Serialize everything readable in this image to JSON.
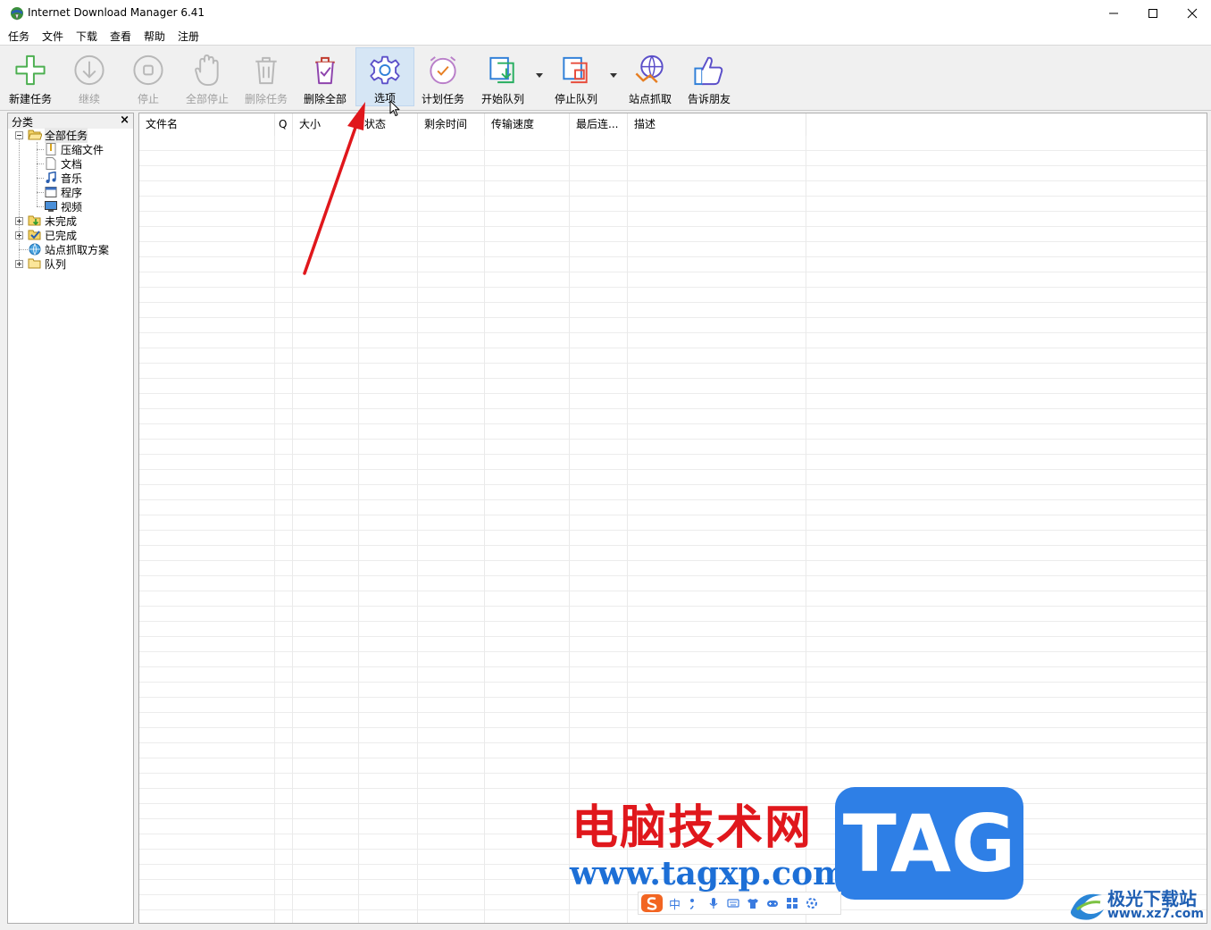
{
  "window": {
    "title": "Internet Download Manager 6.41",
    "minimize_icon": "minimize-icon",
    "maximize_icon": "maximize-icon",
    "close_icon": "close-icon"
  },
  "menu": [
    "任务",
    "文件",
    "下载",
    "查看",
    "帮助",
    "注册"
  ],
  "toolbar": {
    "new_task": "新建任务",
    "resume": "继续",
    "stop": "停止",
    "stop_all": "全部停止",
    "delete_task": "删除任务",
    "delete_all": "删除全部",
    "options": "选项",
    "scheduler": "计划任务",
    "start_queue": "开始队列",
    "stop_queue": "停止队列",
    "site_grabber": "站点抓取",
    "tell_friend": "告诉朋友"
  },
  "sidebar": {
    "title": "分类",
    "close": "×",
    "tree": {
      "all": "全部任务",
      "compressed": "压缩文件",
      "documents": "文档",
      "music": "音乐",
      "programs": "程序",
      "video": "视频",
      "unfinished": "未完成",
      "finished": "已完成",
      "grabber_projects": "站点抓取方案",
      "queues": "队列"
    }
  },
  "columns": [
    "文件名",
    "Q",
    "大小",
    "状态",
    "剩余时间",
    "传输速度",
    "最后连...",
    "描述"
  ],
  "watermarks": {
    "site_cn": "电脑技术网",
    "site_url": "www.tagxp.com",
    "tag": "TAG",
    "ime_label": "中",
    "xz_cn": "极光下载站",
    "xz_url": "www.xz7.com"
  },
  "colors": {
    "annotation_arrow": "#e0171c",
    "options_highlight": "#d6e6f5"
  }
}
